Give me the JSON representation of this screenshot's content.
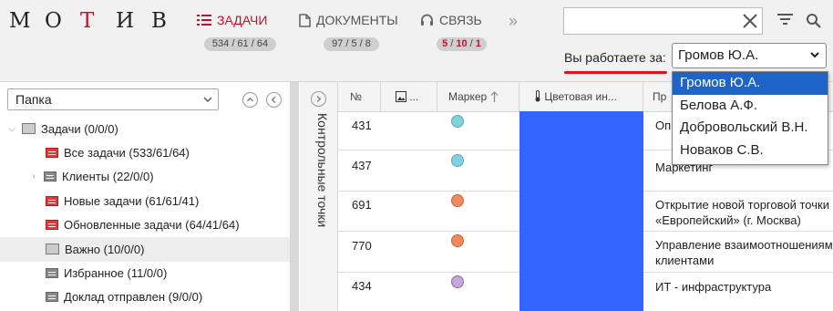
{
  "logo": {
    "letters": [
      "М",
      "О",
      "Т",
      "И",
      "В"
    ]
  },
  "nav": {
    "tasks": {
      "label": "ЗАДАЧИ",
      "counts": "534 / 61 / 64"
    },
    "documents": {
      "label": "ДОКУМЕНТЫ",
      "counts": "97 / 5 / 8"
    },
    "communication": {
      "label": "СВЯЗЬ",
      "count_a": "5",
      "count_b": "10",
      "count_c": "1",
      "sep": " / "
    },
    "more": "»"
  },
  "search": {
    "value": "",
    "placeholder": ""
  },
  "working_for": {
    "label": "Вы работаете за:",
    "selected": "Громов Ю.А.",
    "options": [
      "Громов Ю.А.",
      "Белова А.Ф.",
      "Добровольский В.Н.",
      "Новаков С.В."
    ]
  },
  "folders": {
    "select_label": "Папка",
    "root": "Задачи (0/0/0)",
    "items": [
      {
        "label": "Все задачи (533/61/64)",
        "icon": "red-list-icon"
      },
      {
        "label": "Клиенты (22/0/0)",
        "icon": "gray-list-icon"
      },
      {
        "label": "Новые задачи (61/61/41)",
        "icon": "red-list-icon"
      },
      {
        "label": "Обновленные задачи (64/41/64)",
        "icon": "red-list-icon"
      },
      {
        "label": "Важно (10/0/0)",
        "icon": "folder-icon"
      },
      {
        "label": "Избранное (11/0/0)",
        "icon": "gray-list-icon"
      },
      {
        "label": "Доклад отправлен (9/0/0)",
        "icon": "gray-list-icon"
      }
    ]
  },
  "side_panel": {
    "label": "Контрольные точки"
  },
  "table": {
    "columns": {
      "number": "№",
      "attach": "...",
      "marker": "Маркер",
      "color": "Цветовая ин...",
      "project": "Пр"
    },
    "rows": [
      {
        "number": "431",
        "marker_color": "#7fd3e0",
        "project": "Оп"
      },
      {
        "number": "437",
        "marker_color": "#7fd3e0",
        "project": "Маркетинг"
      },
      {
        "number": "691",
        "marker_color": "#f08a5d",
        "project": "Открытие новой торговой точки",
        "project2": "«Европейский» (г. Москва)"
      },
      {
        "number": "770",
        "marker_color": "#f08a5d",
        "project": "Управление взаимоотношениям",
        "project2": "клиентами"
      },
      {
        "number": "434",
        "marker_color": "#c4a6d8",
        "project": "ИТ - инфраструктура"
      }
    ]
  },
  "colors": {
    "accent": "#c8102e",
    "highlight": "#1e64c8",
    "color_cell": "#3366ff"
  }
}
